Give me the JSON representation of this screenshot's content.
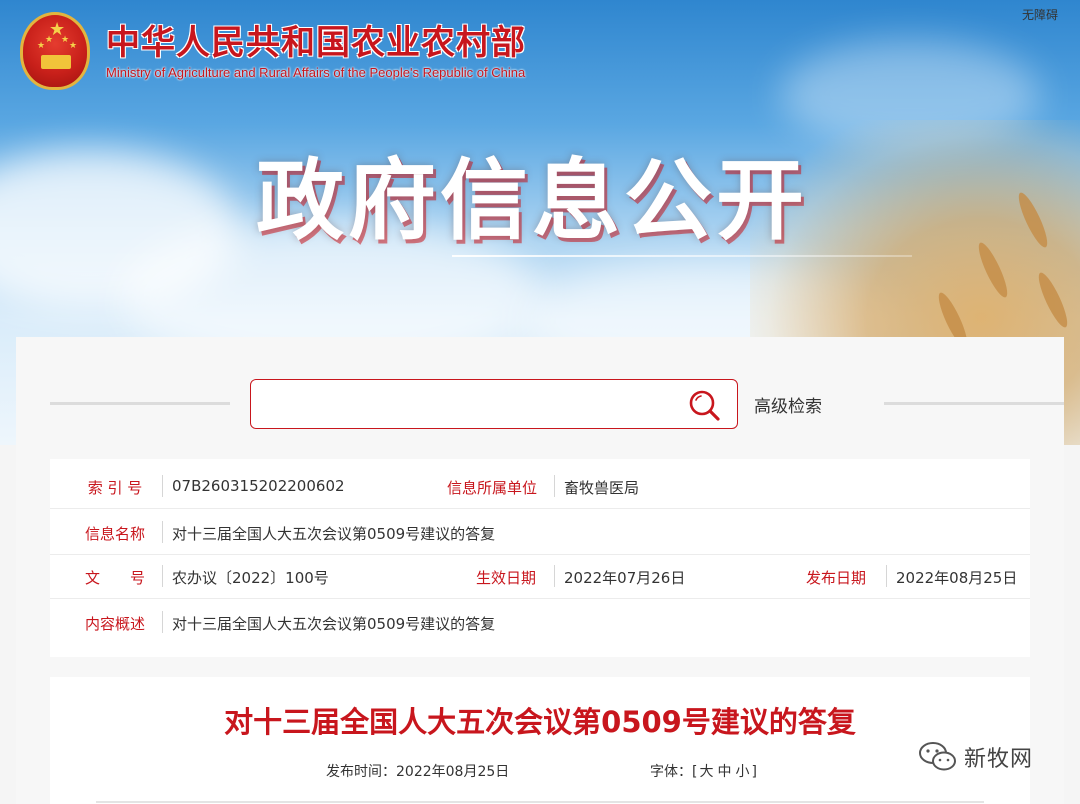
{
  "header": {
    "ministry_name_cn": "中华人民共和国农业农村部",
    "ministry_name_en": "Ministry of Agriculture and Rural Affairs of the People's Republic of China",
    "accessibility_link": "无障碍",
    "emblem_icon": "national-emblem-icon"
  },
  "hero": {
    "title": "政府信息公开"
  },
  "search": {
    "placeholder": "",
    "value": "",
    "advanced_label": "高级检索",
    "icon": "search-icon"
  },
  "info": {
    "index_label": "索 引 号",
    "index_value": "07B260315202200602",
    "unit_label": "信息所属单位",
    "unit_value": "畜牧兽医局",
    "name_label": "信息名称",
    "name_value": "对十三届全国人大五次会议第0509号建议的答复",
    "docno_label": "文　　号",
    "docno_value": "农办议〔2022〕100号",
    "effective_label": "生效日期",
    "effective_value": "2022年07月26日",
    "publish_label": "发布日期",
    "publish_value": "2022年08月25日",
    "summary_label": "内容概述",
    "summary_value": "对十三届全国人大五次会议第0509号建议的答复"
  },
  "article": {
    "title": "对十三届全国人大五次会议第0509号建议的答复",
    "publish_time_label": "发布时间：",
    "publish_time_value": "2022年08月25日",
    "font_label": "字体：",
    "font_bracket_open": "[",
    "font_large": "大",
    "font_medium": "中",
    "font_small": "小",
    "font_bracket_close": "]"
  },
  "watermark": {
    "text": "新牧网",
    "icon": "wechat-icon"
  },
  "colors": {
    "accent": "#c8161d",
    "text": "#333333",
    "panel_bg": "#f7f7f7"
  }
}
